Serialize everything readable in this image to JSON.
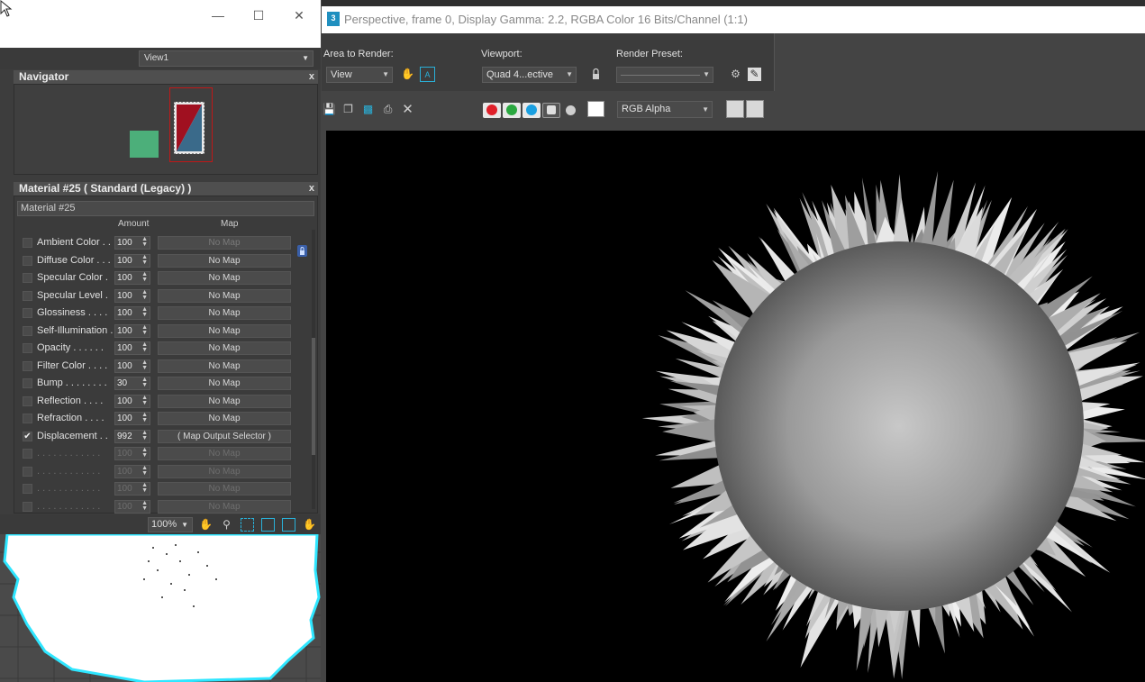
{
  "left_window": {
    "title": "",
    "view_dropdown": "View1",
    "navigator": {
      "title": "Navigator",
      "close": "x"
    },
    "material": {
      "title": "Material #25  ( Standard (Legacy) )",
      "name_field": "Material #25",
      "close": "x",
      "col_amount": "Amount",
      "col_map": "Map",
      "rows": [
        {
          "label": "Ambient Color . .",
          "amount": "100",
          "map": "No Map",
          "checked": false,
          "state": "faint"
        },
        {
          "label": "Diffuse Color . . .",
          "amount": "100",
          "map": "No Map",
          "checked": false,
          "state": "normal"
        },
        {
          "label": "Specular Color  .",
          "amount": "100",
          "map": "No Map",
          "checked": false,
          "state": "normal"
        },
        {
          "label": "Specular Level  .",
          "amount": "100",
          "map": "No Map",
          "checked": false,
          "state": "normal"
        },
        {
          "label": "Glossiness  . . . .",
          "amount": "100",
          "map": "No Map",
          "checked": false,
          "state": "normal"
        },
        {
          "label": "Self-Illumination .",
          "amount": "100",
          "map": "No Map",
          "checked": false,
          "state": "normal"
        },
        {
          "label": "Opacity . . . . . .",
          "amount": "100",
          "map": "No Map",
          "checked": false,
          "state": "normal"
        },
        {
          "label": "Filter Color  . . . .",
          "amount": "100",
          "map": "No Map",
          "checked": false,
          "state": "normal"
        },
        {
          "label": "Bump  . . . . . . . .",
          "amount": "30",
          "map": "No Map",
          "checked": false,
          "state": "normal"
        },
        {
          "label": "Reflection  . . . .",
          "amount": "100",
          "map": "No Map",
          "checked": false,
          "state": "normal"
        },
        {
          "label": "Refraction  . . . .",
          "amount": "100",
          "map": "No Map",
          "checked": false,
          "state": "normal"
        },
        {
          "label": "Displacement  . .",
          "amount": "992",
          "map": "( Map Output Selector )",
          "checked": true,
          "state": "normal"
        },
        {
          "label": ". . . . . . . . . . . .",
          "amount": "100",
          "map": "No Map",
          "checked": false,
          "state": "dim"
        },
        {
          "label": ". . . . . . . . . . . .",
          "amount": "100",
          "map": "No Map",
          "checked": false,
          "state": "dim"
        },
        {
          "label": ". . . . . . . . . . . .",
          "amount": "100",
          "map": "No Map",
          "checked": false,
          "state": "dim"
        },
        {
          "label": ". . . . . . . . . . . .",
          "amount": "100",
          "map": "No Map",
          "checked": false,
          "state": "dim"
        }
      ]
    },
    "zoom": "100%"
  },
  "right_window": {
    "title": "Perspective, frame 0, Display Gamma: 2.2, RGBA Color 16 Bits/Channel (1:1)",
    "app_icon": "3",
    "area_to_render_label": "Area to Render:",
    "area_to_render_value": "View",
    "viewport_label": "Viewport:",
    "viewport_value": "Quad 4...ective",
    "render_preset_label": "Render Preset:",
    "render_preset_value": "",
    "channel_value": "RGB Alpha"
  },
  "colors": {
    "red_channel": "#e0202a",
    "green_channel": "#2aa840",
    "blue_channel": "#1a9fe0",
    "accent_green_node": "#4caf7a"
  }
}
